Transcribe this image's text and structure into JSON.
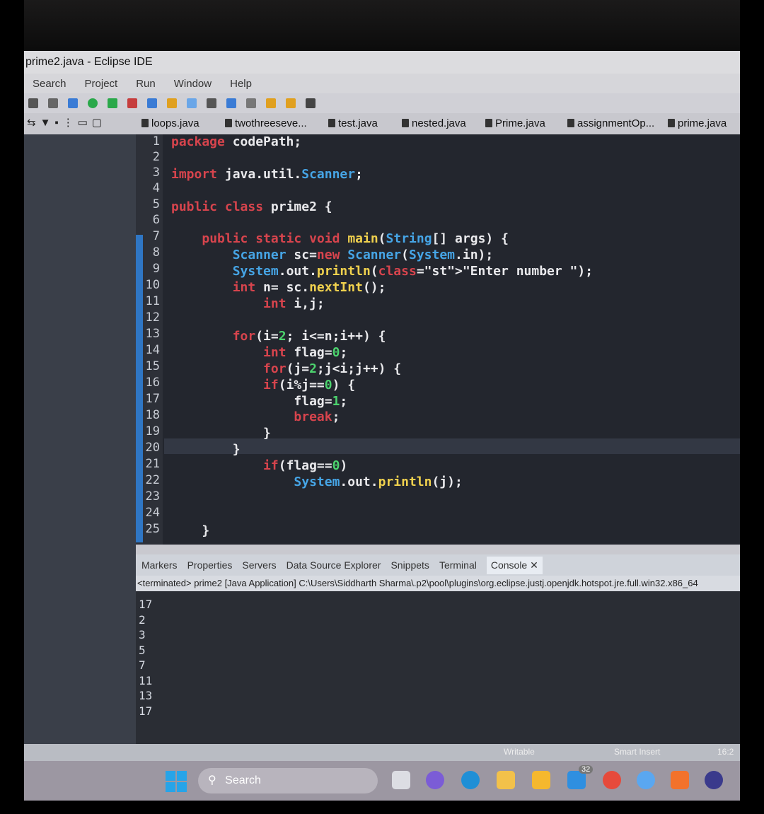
{
  "window": {
    "title": "prime2.java - Eclipse IDE"
  },
  "menu": [
    "Search",
    "Project",
    "Run",
    "Window",
    "Help"
  ],
  "editor_tabs": [
    "loops.java",
    "twothreeseve...",
    "test.java",
    "nested.java",
    "Prime.java",
    "assignmentOp...",
    "prime.java"
  ],
  "code_lines": [
    {
      "n": "1",
      "text": "package codePath;"
    },
    {
      "n": "2",
      "text": ""
    },
    {
      "n": "3",
      "text": "import java.util.Scanner;"
    },
    {
      "n": "4",
      "text": ""
    },
    {
      "n": "5",
      "text": "public class prime2 {"
    },
    {
      "n": "6",
      "text": ""
    },
    {
      "n": "7",
      "text": "    public static void main(String[] args) {"
    },
    {
      "n": "8",
      "text": "        Scanner sc=new Scanner(System.in);"
    },
    {
      "n": "9",
      "text": "        System.out.println(\"Enter number \");"
    },
    {
      "n": "10",
      "text": "        int n= sc.nextInt();"
    },
    {
      "n": "11",
      "text": "            int i,j;"
    },
    {
      "n": "12",
      "text": ""
    },
    {
      "n": "13",
      "text": "        for(i=2; i<=n;i++) {"
    },
    {
      "n": "14",
      "text": "            int flag=0;"
    },
    {
      "n": "15",
      "text": "            for(j=2;j<i;j++) {"
    },
    {
      "n": "16",
      "text": "            if(i%j==0) {"
    },
    {
      "n": "17",
      "text": "                flag=1;"
    },
    {
      "n": "18",
      "text": "                break;"
    },
    {
      "n": "19",
      "text": "            }"
    },
    {
      "n": "20",
      "text": "        }"
    },
    {
      "n": "21",
      "text": "            if(flag==0)"
    },
    {
      "n": "22",
      "text": "                System.out.println(j);"
    },
    {
      "n": "23",
      "text": ""
    },
    {
      "n": "24",
      "text": ""
    },
    {
      "n": "25",
      "text": "    }"
    }
  ],
  "bottom_tabs": [
    "Markers",
    "Properties",
    "Servers",
    "Data Source Explorer",
    "Snippets",
    "Terminal",
    "Console"
  ],
  "console": {
    "header": "<terminated> prime2 [Java Application] C:\\Users\\Siddharth Sharma\\.p2\\pool\\plugins\\org.eclipse.justj.openjdk.hotspot.jre.full.win32.x86_64",
    "output": [
      "17",
      "2",
      "3",
      "5",
      "7",
      "11",
      "13",
      "17"
    ]
  },
  "status": {
    "writable": "Writable",
    "insert": "Smart Insert",
    "pos": "16:2"
  },
  "taskbar": {
    "search": "Search",
    "badge": "32"
  },
  "colors": {
    "keyword": "#d7444d",
    "type": "#46a5e6",
    "method": "#f0d14e",
    "number": "#4cd36e",
    "gutter_bar": "#2f76c4"
  }
}
